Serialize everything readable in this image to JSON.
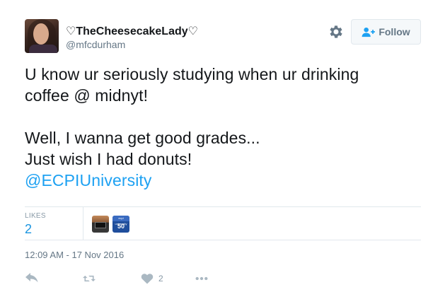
{
  "author": {
    "name": "♡TheCheesecakeLady♡",
    "handle": "@mfcdurham"
  },
  "header": {
    "settings_icon": "gear-icon",
    "follow_label": "Follow",
    "follow_icon": "add-user-icon"
  },
  "tweet": {
    "lines": [
      "U know ur seriously studying when ur drinking",
      "coffee @ midnyt!",
      "",
      "Well, I wanna get good grades...",
      "Just wish I had donuts!"
    ],
    "mention": "@ECPIUniversity"
  },
  "stats": {
    "likes_label": "LIKES",
    "likes_count": "2",
    "likers": [
      {
        "avatar": "dark-desk-avatar"
      },
      {
        "avatar": "ecpi-badge-avatar",
        "badge_text": "ecpi university",
        "badge_number": "50"
      }
    ]
  },
  "timestamp": "12:09 AM - 17 Nov 2016",
  "actions": {
    "reply_icon": "reply-icon",
    "retweet_icon": "retweet-icon",
    "like_icon": "heart-icon",
    "like_count": "2",
    "more_icon": "more-icon"
  },
  "colors": {
    "text": "#14171a",
    "secondary": "#657786",
    "muted": "#8899a6",
    "link": "#1da1f2",
    "border": "#e1e8ed"
  }
}
